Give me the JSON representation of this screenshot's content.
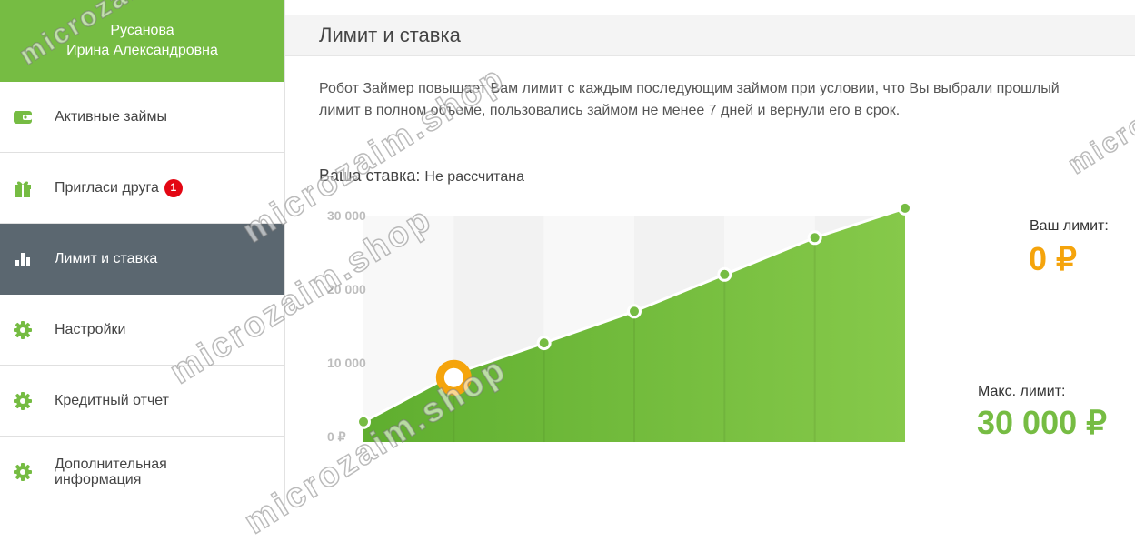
{
  "user": {
    "line1": "Русанова",
    "line2": "Ирина Александровна"
  },
  "menu": [
    {
      "label": "Активные займы",
      "icon": "wallet-icon"
    },
    {
      "label": "Пригласи друга",
      "icon": "gift-icon",
      "badge": "1"
    },
    {
      "label": "Лимит и ставка",
      "icon": "bar-chart-icon",
      "active": true
    },
    {
      "label": "Настройки",
      "icon": "gear-icon"
    },
    {
      "label": "Кредитный отчет",
      "icon": "gear-icon"
    },
    {
      "label": "Дополнительная информация",
      "icon": "gear-icon"
    }
  ],
  "page": {
    "title": "Лимит и ставка",
    "description": "Робот Займер повышает Вам лимит с каждым последующим займом при условии, что Вы выбрали прошлый лимит в полном объеме, пользовались займом не менее 7 дней и вернули его в срок.",
    "rate_label": "Ваша ставка:",
    "rate_value": "Не рассчитана"
  },
  "limits": {
    "your_label": "Ваш лимит:",
    "your_value": "0 ₽",
    "max_label": "Макс. лимит:",
    "max_value": "30 000 ₽"
  },
  "colors": {
    "brand_green": "#76bc43",
    "accent_orange": "#f5a40c",
    "active_menu": "#5b6770",
    "badge_red": "#e30613"
  },
  "chart_data": {
    "type": "area",
    "y_ticks": [
      "0 ₽",
      "10 000",
      "20 000",
      "30 000"
    ],
    "ylim": [
      0,
      30000
    ],
    "x": [
      0,
      1,
      2,
      3,
      4,
      5,
      6
    ],
    "values": [
      2000,
      8500,
      12700,
      17000,
      22000,
      27000,
      31000
    ],
    "current_marker": {
      "x": 1,
      "value": 8000
    }
  },
  "watermark": "microzaim.shop"
}
